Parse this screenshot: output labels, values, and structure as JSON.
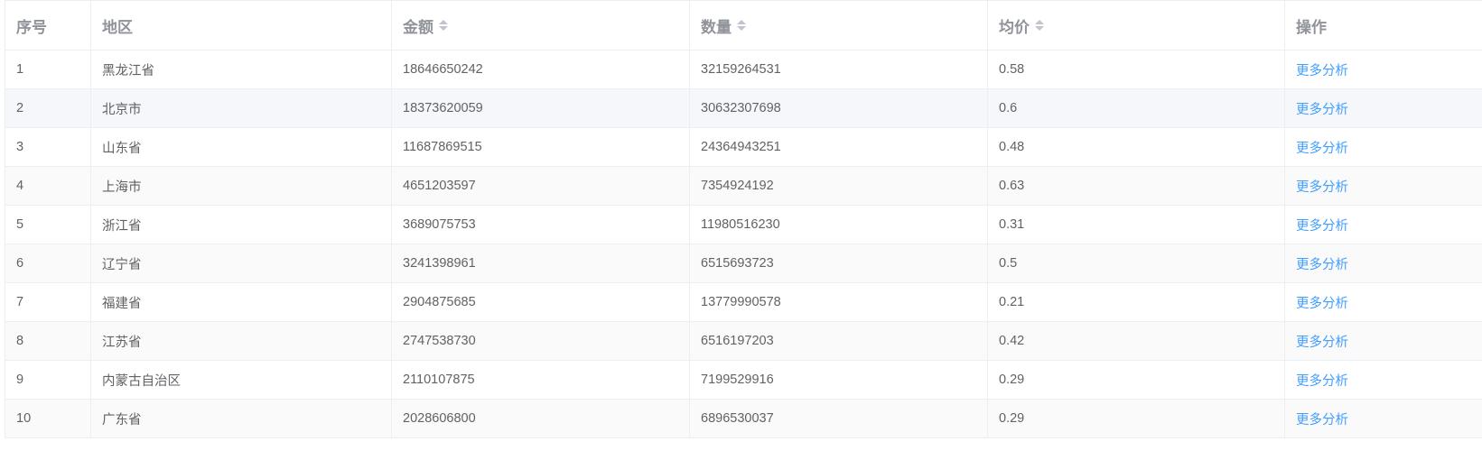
{
  "table": {
    "headers": {
      "index": "序号",
      "region": "地区",
      "amount": "金额",
      "quantity": "数量",
      "avg_price": "均价",
      "action": "操作"
    },
    "sortable_columns": [
      "金额",
      "数量",
      "均价"
    ],
    "rows": [
      {
        "index": "1",
        "region": "黑龙江省",
        "amount": "18646650242",
        "quantity": "32159264531",
        "avg_price": "0.58",
        "action": "更多分析"
      },
      {
        "index": "2",
        "region": "北京市",
        "amount": "18373620059",
        "quantity": "30632307698",
        "avg_price": "0.6",
        "action": "更多分析"
      },
      {
        "index": "3",
        "region": "山东省",
        "amount": "11687869515",
        "quantity": "24364943251",
        "avg_price": "0.48",
        "action": "更多分析"
      },
      {
        "index": "4",
        "region": "上海市",
        "amount": "4651203597",
        "quantity": "7354924192",
        "avg_price": "0.63",
        "action": "更多分析"
      },
      {
        "index": "5",
        "region": "浙江省",
        "amount": "3689075753",
        "quantity": "11980516230",
        "avg_price": "0.31",
        "action": "更多分析"
      },
      {
        "index": "6",
        "region": "辽宁省",
        "amount": "3241398961",
        "quantity": "6515693723",
        "avg_price": "0.5",
        "action": "更多分析"
      },
      {
        "index": "7",
        "region": "福建省",
        "amount": "2904875685",
        "quantity": "13779990578",
        "avg_price": "0.21",
        "action": "更多分析"
      },
      {
        "index": "8",
        "region": "江苏省",
        "amount": "2747538730",
        "quantity": "6516197203",
        "avg_price": "0.42",
        "action": "更多分析"
      },
      {
        "index": "9",
        "region": "内蒙古自治区",
        "amount": "2110107875",
        "quantity": "7199529916",
        "avg_price": "0.29",
        "action": "更多分析"
      },
      {
        "index": "10",
        "region": "广东省",
        "amount": "2028606800",
        "quantity": "6896530037",
        "avg_price": "0.29",
        "action": "更多分析"
      }
    ]
  },
  "colors": {
    "header_text": "#909399",
    "cell_text": "#606266",
    "link": "#409eff",
    "border": "#ebeef5",
    "stripe": "#f5f7fa"
  }
}
